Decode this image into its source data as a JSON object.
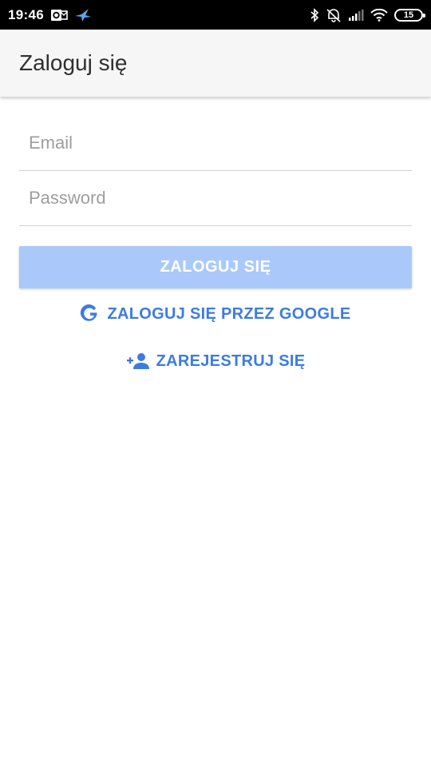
{
  "status_bar": {
    "time": "19:46",
    "battery": "15",
    "icons": [
      "outlook-icon",
      "bird-icon",
      "bluetooth-icon",
      "alarm-off-icon",
      "signal-icon",
      "wifi-icon",
      "battery-icon"
    ]
  },
  "app_bar": {
    "title": "Zaloguj się"
  },
  "form": {
    "email_placeholder": "Email",
    "password_placeholder": "Password"
  },
  "actions": {
    "login_label": "ZALOGUJ SIĘ",
    "google_label": "ZALOGUJ SIĘ PRZEZ GOOGLE",
    "register_label": "ZAREJESTRUJ SIĘ"
  },
  "colors": {
    "accent": "#3c7ce0",
    "login_button_disabled": "#aac9fa",
    "app_bar_bg": "#f6f6f6"
  }
}
